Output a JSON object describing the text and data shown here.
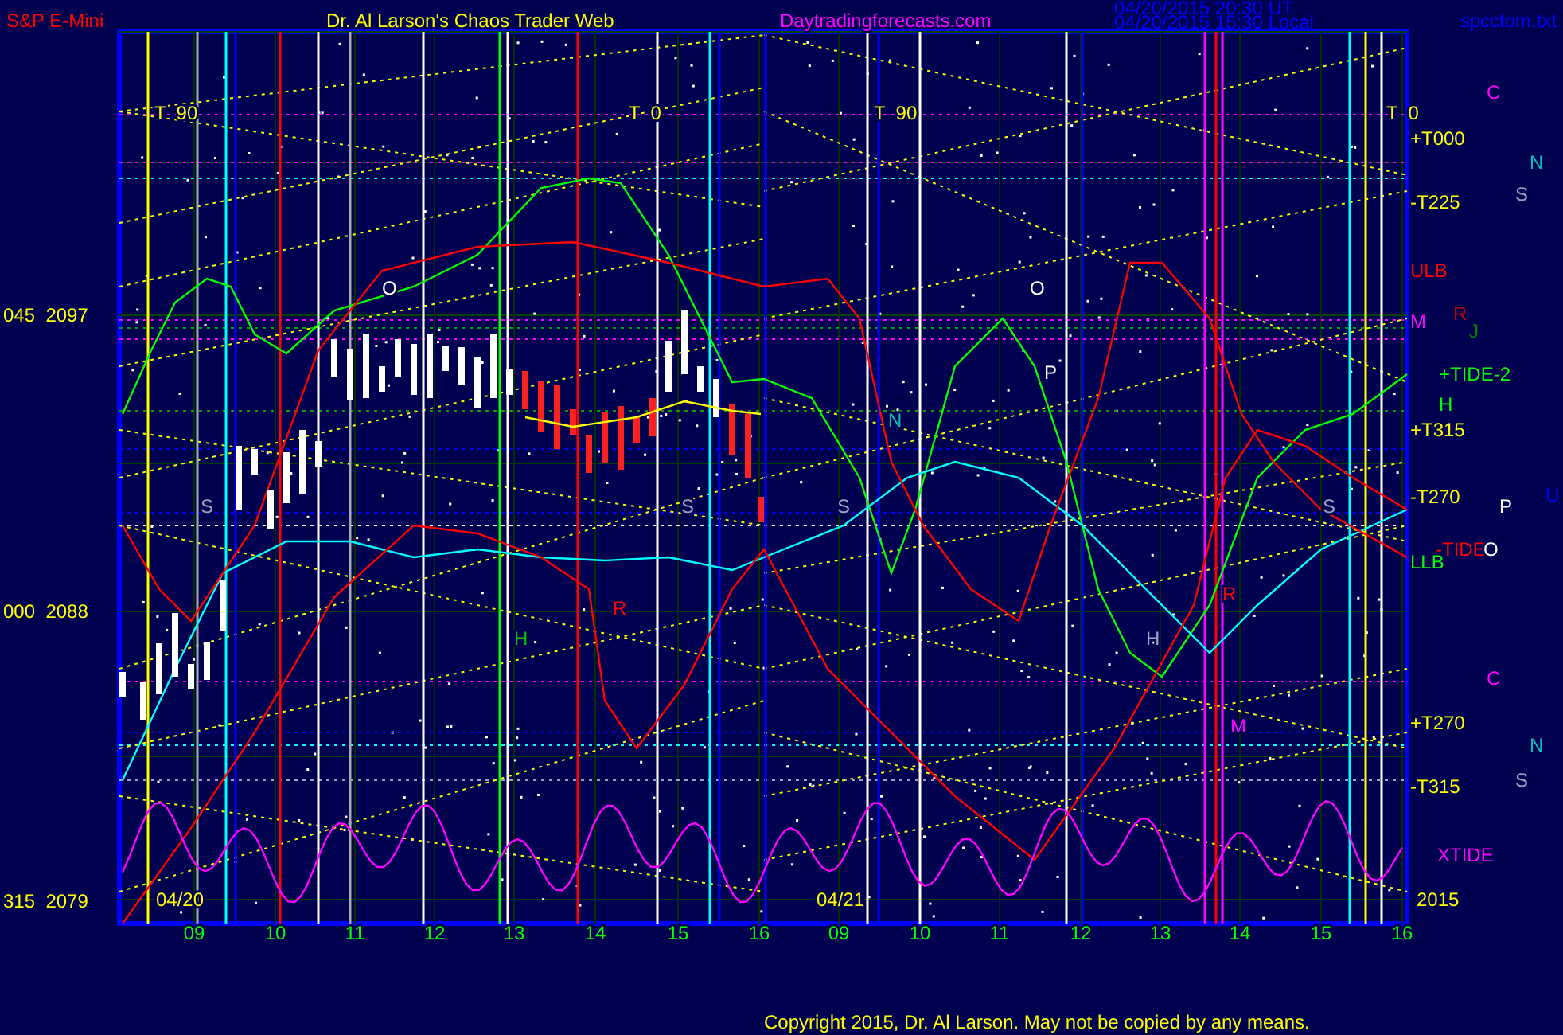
{
  "header": {
    "symbol": "S&P E-Mini",
    "title": "Dr. Al Larson's Chaos Trader Web",
    "website": "Daytradingforecasts.com",
    "timestamps": [
      "04/20/2015 20:30 UT",
      "04/20/2015 15:30 Local"
    ],
    "file": "spcctom.txt"
  },
  "y_axis": [
    "045  2097",
    "000  2088",
    "315  2079"
  ],
  "x_axis": {
    "hours": [
      "09",
      "10",
      "11",
      "12",
      "13",
      "14",
      "15",
      "16",
      "09",
      "10",
      "11",
      "12",
      "13",
      "14",
      "15",
      "16"
    ],
    "dates": [
      "04/20",
      "04/21"
    ],
    "year": "2015"
  },
  "plot_labels": [
    {
      "text": "T  90",
      "color": "#ffff00"
    },
    {
      "text": "T  0",
      "color": "#ffff00"
    },
    {
      "text": "T  90",
      "color": "#ffff00"
    },
    {
      "text": "T  0",
      "color": "#ffff00"
    },
    {
      "text": "O",
      "color": "#ffffff"
    },
    {
      "text": "O",
      "color": "#ffffff"
    },
    {
      "text": "P",
      "color": "#ffffff"
    },
    {
      "text": "N",
      "color": "#00c0c0"
    },
    {
      "text": "S",
      "color": "#a0a0c0"
    },
    {
      "text": "S",
      "color": "#a0a0c0"
    },
    {
      "text": "S",
      "color": "#a0a0c0"
    },
    {
      "text": "S",
      "color": "#a0a0c0"
    },
    {
      "text": "H",
      "color": "#00c000"
    },
    {
      "text": "H",
      "color": "#a0a0c0"
    },
    {
      "text": "R",
      "color": "#ff0000"
    },
    {
      "text": "R",
      "color": "#ff0000"
    },
    {
      "text": "M",
      "color": "#ff00ff"
    }
  ],
  "line_labels": [
    {
      "text": "+T000",
      "color": "#ffff00"
    },
    {
      "text": "-T225",
      "color": "#ffff00"
    },
    {
      "text": "ULB",
      "color": "#ff0000"
    },
    {
      "text": "M",
      "color": "#ff00ff"
    },
    {
      "text": "+TIDE-2",
      "color": "#00ff00"
    },
    {
      "text": "H",
      "color": "#00ff00"
    },
    {
      "text": "+T315",
      "color": "#ffff00"
    },
    {
      "text": "-T270",
      "color": "#ffff00"
    },
    {
      "text": "-TIDE",
      "color": "#ff0000"
    },
    {
      "text": "O",
      "color": "#ffffff"
    },
    {
      "text": "LLB",
      "color": "#00ff00"
    },
    {
      "text": "+T270",
      "color": "#ffff00"
    },
    {
      "text": "-T315",
      "color": "#ffff00"
    },
    {
      "text": "XTIDE",
      "color": "#ff00ff"
    }
  ],
  "planet_markers": [
    {
      "text": "C",
      "color": "#ff00ff"
    },
    {
      "text": "N",
      "color": "#00c0c0"
    },
    {
      "text": "S",
      "color": "#a0a0c0"
    },
    {
      "text": "R",
      "color": "#c00000"
    },
    {
      "text": "J",
      "color": "#008000"
    },
    {
      "text": "P",
      "color": "#ffffff"
    },
    {
      "text": "U",
      "color": "#0000ff"
    },
    {
      "text": "C",
      "color": "#ff00ff"
    },
    {
      "text": "N",
      "color": "#00c0c0"
    },
    {
      "text": "S",
      "color": "#a0a0c0"
    }
  ],
  "copyright": "Copyright 2015, Dr. Al Larson. May not be copied by any means."
}
